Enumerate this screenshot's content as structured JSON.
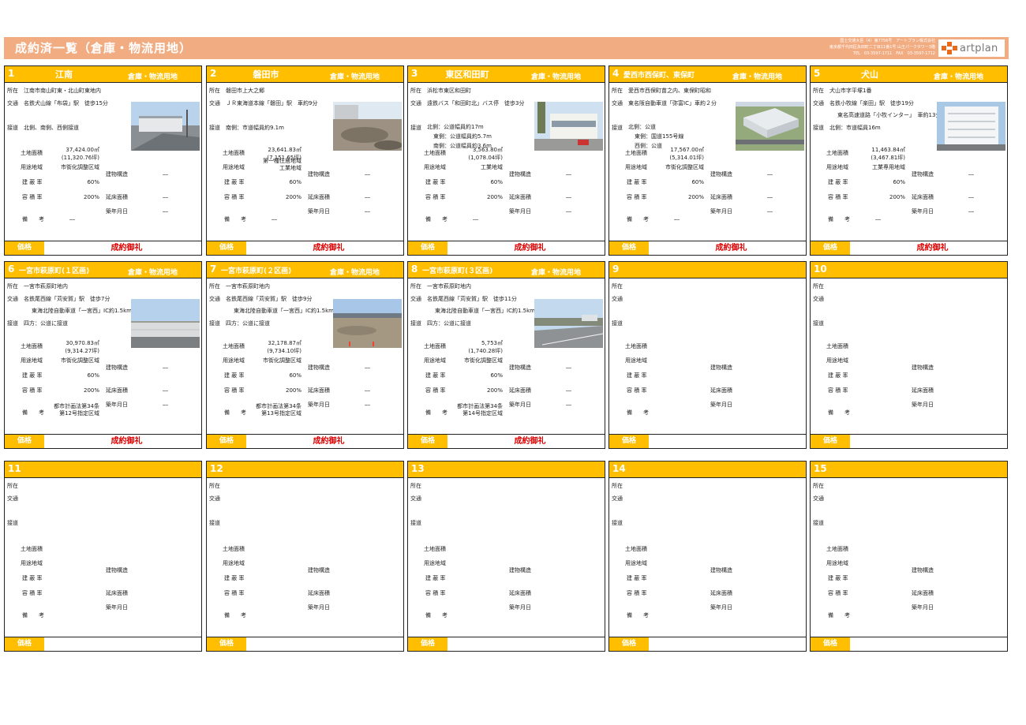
{
  "page": {
    "title": "成約済一覧（倉庫・物流用地）",
    "company_lines": [
      "国土交通大臣（4）第7756号　アートプラン株式会社",
      "東京都千代田区永田町二丁目11番1号 山王パークタワー3階",
      "TEL　03-3597-1711　FAX　03-3597-1712"
    ],
    "logo_text": "artplan",
    "colors": {
      "header": "#f2ac82",
      "card_header": "#ffbf00",
      "sold": "#e00000",
      "logo": "#ea6a1c"
    }
  },
  "labels": {
    "shozai": "所在",
    "kotsu": "交通",
    "setsudo": "接道",
    "tochi": "土地面積",
    "yoto": "用途地域",
    "kenpei": "建 蔽 率",
    "yoseki": "容 積 率",
    "biko": "備　　考",
    "kozo": "建物構造",
    "nobeyuka": "延床面積",
    "chiku": "築年月日",
    "price": "価格"
  },
  "cards": [
    {
      "num": "1",
      "place": "江南",
      "category": "倉庫・物流用地",
      "address": "江南市南山町東・北山町東地内",
      "traffic": [
        "名鉄犬山線「布袋」駅　徒歩15分"
      ],
      "road": [
        "北側、南側、西側接道"
      ],
      "area": "37,424.00㎡",
      "area_tsubo": "(11,320.76坪)",
      "zoning": "市街化調整区域",
      "bcr": "60%",
      "far": "200%",
      "remarks": "―",
      "structure": "―",
      "floor": "―",
      "built": "―",
      "price": "成約御礼",
      "photo": "warehouse-street"
    },
    {
      "num": "2",
      "place": "磐田市",
      "category": "倉庫・物流用地",
      "address": "磐田市上大之郷",
      "traffic": [
        "ＪＲ東海道本線「磐田」駅　車約9分"
      ],
      "road": [
        "南側：市道幅員約9.1m"
      ],
      "area": "23,641.83㎡",
      "area_tsubo": "(7,151.65坪)",
      "zoning": "第一種住居地域\n工業地域",
      "bcr": "60%",
      "far": "200%",
      "remarks": "―",
      "structure": "―",
      "floor": "―",
      "built": "―",
      "price": "成約御礼",
      "photo": "vacant-land"
    },
    {
      "num": "3",
      "place": "東区和田町",
      "category": "倉庫・物流用地",
      "address": "浜松市東区和田町",
      "traffic": [
        "遠鉄バス「和田町北」バス停　徒歩3分"
      ],
      "road": [
        "北側：公道幅員約17m",
        "東側：公道幅員約5.7m",
        "南側：公道幅員約3.6m"
      ],
      "area": "3,563.80㎡",
      "area_tsubo": "(1,078.04坪)",
      "zoning": "工業地域",
      "bcr": "60%",
      "far": "200%",
      "remarks": "―",
      "structure": "―",
      "floor": "―",
      "built": "―",
      "price": "成約御礼",
      "photo": "roadside-building"
    },
    {
      "num": "4",
      "place": "愛西市西保町、東保町",
      "category": "倉庫・物流用地",
      "address": "愛西市西保町苗之内、東保町昭和",
      "traffic": [
        "東名阪自動車道「弥富IC」車約２分"
      ],
      "road": [
        "北側：公道",
        "東側：国道155号線",
        "西側：公道"
      ],
      "area": "17,567.00㎡",
      "area_tsubo": "(5,314.01坪)",
      "zoning": "市街化調整区域",
      "bcr": "60%",
      "far": "200%",
      "remarks": "―",
      "structure": "―",
      "floor": "―",
      "built": "―",
      "price": "成約御礼",
      "photo": "aerial-warehouse"
    },
    {
      "num": "5",
      "place": "犬山",
      "category": "倉庫・物流用地",
      "address": "犬山市字平塚1番",
      "traffic": [
        "名鉄小牧線「楽田」駅　徒歩19分",
        "東名高速道路「小牧インター」　車約13分"
      ],
      "road": [
        "北側：市道幅員16m"
      ],
      "area": "11,463.84㎡",
      "area_tsubo": "(3,467.81坪)",
      "zoning": "工業専用地域",
      "bcr": "60%",
      "far": "200%",
      "remarks": "―",
      "structure": "―",
      "floor": "―",
      "built": "―",
      "price": "成約御礼",
      "photo": "white-warehouse"
    },
    {
      "num": "6",
      "place": "一宮市萩原町(１区画)",
      "category": "倉庫・物流用地",
      "address": "一宮市萩原町地内",
      "traffic": [
        "名鉄尾西線「苅安賀」駅　徒歩7分",
        "東海北陸自動車道「一宮西」IC約1.5km"
      ],
      "road": [
        "四方：公道に接道"
      ],
      "area": "30,970.83㎡",
      "area_tsubo": "(9,314.27坪)",
      "zoning": "市街化調整区域",
      "bcr": "60%",
      "far": "200%",
      "remarks": "都市計画法第34条\n第12号指定区域",
      "structure": "―",
      "floor": "―",
      "built": "―",
      "price": "成約御礼",
      "photo": "fenced-lot"
    },
    {
      "num": "7",
      "place": "一宮市萩原町(２区画)",
      "category": "倉庫・物流用地",
      "address": "一宮市萩原町地内",
      "traffic": [
        "名鉄尾西線「苅安賀」駅　徒歩9分",
        "東海北陸自動車道「一宮西」IC約1.5km"
      ],
      "road": [
        "四方：公道に接道"
      ],
      "area": "32,178.87㎡",
      "area_tsubo": "(9,734.10坪)",
      "zoning": "市街化調整区域",
      "bcr": "60%",
      "far": "200%",
      "remarks": "都市計画法第34条\n第13号指定区域",
      "structure": "―",
      "floor": "―",
      "built": "―",
      "price": "成約御礼",
      "photo": "open-lot"
    },
    {
      "num": "8",
      "place": "一宮市萩原町(３区画)",
      "category": "倉庫・物流用地",
      "address": "一宮市萩原町地内",
      "traffic": [
        "名鉄尾西線「苅安賀」駅　徒歩11分",
        "東海北陸自動車道「一宮西」IC約1.5km"
      ],
      "road": [
        "四方：公道に接道"
      ],
      "area": "5,753㎡",
      "area_tsubo": "(1,740.28坪)",
      "zoning": "市街化調整区域",
      "bcr": "60%",
      "far": "200%",
      "remarks": "都市計画法第34条\n第14号指定区域",
      "structure": "―",
      "floor": "―",
      "built": "―",
      "price": "成約御礼",
      "photo": "road-lot"
    },
    {
      "num": "9"
    },
    {
      "num": "10"
    },
    {
      "num": "11"
    },
    {
      "num": "12"
    },
    {
      "num": "13"
    },
    {
      "num": "14"
    },
    {
      "num": "15"
    }
  ]
}
